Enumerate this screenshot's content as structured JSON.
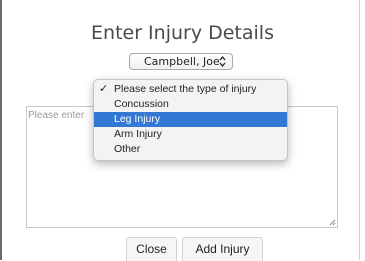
{
  "dialog": {
    "title": "Enter Injury Details"
  },
  "patient_select": {
    "value": "Campbell, Joe",
    "arrows_icon": "up-down-chevron-icon"
  },
  "injury_type_dropdown": {
    "options": [
      {
        "label": "Please select the type of injury",
        "checked": true,
        "highlighted": false
      },
      {
        "label": "Concussion",
        "checked": false,
        "highlighted": false
      },
      {
        "label": "Leg Injury",
        "checked": false,
        "highlighted": true
      },
      {
        "label": "Arm Injury",
        "checked": false,
        "highlighted": false
      },
      {
        "label": "Other",
        "checked": false,
        "highlighted": false
      }
    ],
    "check_glyph": "✓",
    "highlight_color": "#3478d6"
  },
  "notes": {
    "placeholder": "Please enter"
  },
  "buttons": {
    "close_label": "Close",
    "add_label": "Add Injury"
  }
}
